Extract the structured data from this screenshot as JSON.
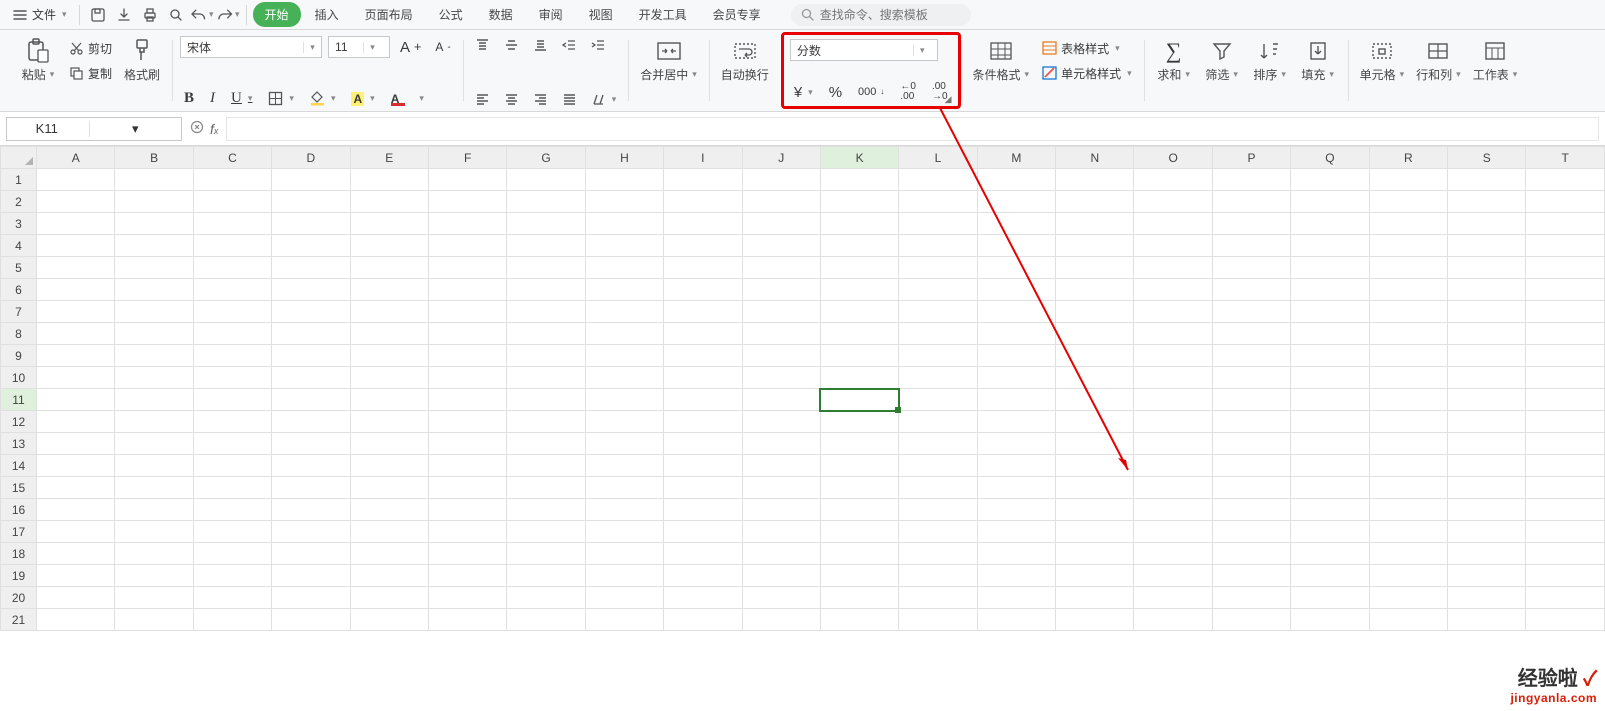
{
  "menubar": {
    "file_label": "文件",
    "tabs": [
      "开始",
      "插入",
      "页面布局",
      "公式",
      "数据",
      "审阅",
      "视图",
      "开发工具",
      "会员专享"
    ],
    "active_tab_index": 0,
    "search_placeholder": "查找命令、搜索模板"
  },
  "ribbon": {
    "paste_label": "粘贴",
    "cut_label": "剪切",
    "copy_label": "复制",
    "format_painter_label": "格式刷",
    "font_name": "宋体",
    "font_size": "11",
    "merge_label": "合并居中",
    "wrap_label": "自动换行",
    "number_format": "分数",
    "cond_format_label": "条件格式",
    "table_style_label": "表格样式",
    "cell_style_label": "单元格样式",
    "sum_label": "求和",
    "filter_label": "筛选",
    "sort_label": "排序",
    "fill_label": "填充",
    "cells_label": "单元格",
    "rowcol_label": "行和列",
    "sheet_label": "工作表"
  },
  "namebox": {
    "value": "K11"
  },
  "grid": {
    "columns": [
      "A",
      "B",
      "C",
      "D",
      "E",
      "F",
      "G",
      "H",
      "I",
      "J",
      "K",
      "L",
      "M",
      "N",
      "O",
      "P",
      "Q",
      "R",
      "S",
      "T"
    ],
    "rows": 21,
    "active_col_index": 10,
    "active_row_index": 10
  },
  "watermark": {
    "line1": "经验啦",
    "line2": "jingyanla.com"
  }
}
